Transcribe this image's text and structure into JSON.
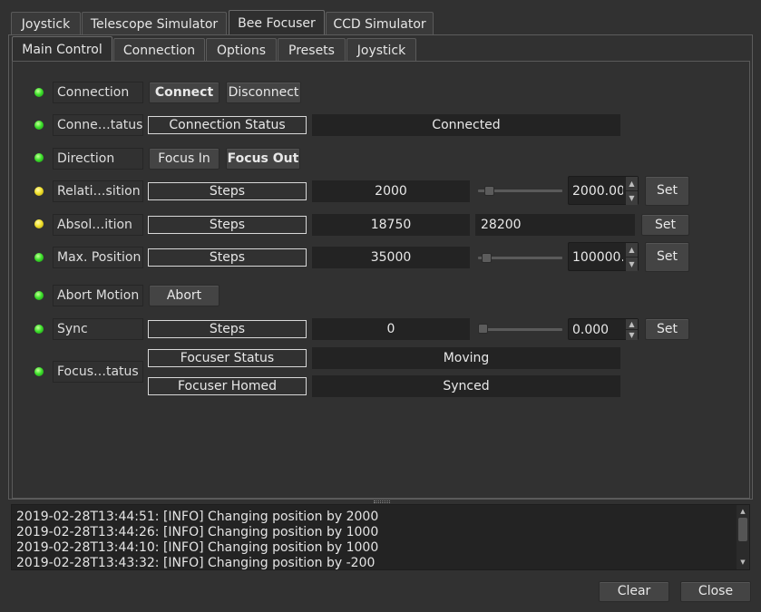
{
  "top_tabs": [
    {
      "label": "Joystick",
      "active": false
    },
    {
      "label": "Telescope Simulator",
      "active": false
    },
    {
      "label": "Bee Focuser",
      "active": true
    },
    {
      "label": "CCD Simulator",
      "active": false
    }
  ],
  "sub_tabs": [
    {
      "label": "Main Control",
      "active": true
    },
    {
      "label": "Connection",
      "active": false
    },
    {
      "label": "Options",
      "active": false
    },
    {
      "label": "Presets",
      "active": false
    },
    {
      "label": "Joystick",
      "active": false
    }
  ],
  "colors": {
    "led_green": "#3ee22c",
    "led_yellow": "#f2e12c"
  },
  "rows": {
    "connection": {
      "status": "green",
      "label": "Connection",
      "connect": "Connect",
      "disconnect": "Disconnect"
    },
    "conn_status": {
      "status": "green",
      "label": "Conne…tatus",
      "field_label": "Connection Status",
      "value": "Connected"
    },
    "direction": {
      "status": "green",
      "label": "Direction",
      "focus_in": "Focus In",
      "focus_out": "Focus Out"
    },
    "relative": {
      "status": "yellow",
      "label": "Relati…sition",
      "unit": "Steps",
      "value": "2000",
      "spin": "2000.00",
      "set": "Set",
      "slider_pct": 8
    },
    "absolute": {
      "status": "yellow",
      "label": "Absol…ition",
      "unit": "Steps",
      "value": "18750",
      "input": "28200",
      "set": "Set"
    },
    "max_position": {
      "status": "green",
      "label": "Max. Position",
      "unit": "Steps",
      "value": "35000",
      "spin": "100000.0",
      "set": "Set",
      "slider_pct": 5
    },
    "abort": {
      "status": "green",
      "label": "Abort Motion",
      "button": "Abort"
    },
    "sync": {
      "status": "green",
      "label": "Sync",
      "unit": "Steps",
      "value": "0",
      "spin": "0.000",
      "set": "Set",
      "slider_pct": 0
    },
    "focuser_status": {
      "status": "green",
      "label": "Focus…tatus",
      "status_label": "Focuser Status",
      "status_value": "Moving",
      "homed_label": "Focuser Homed",
      "homed_value": "Synced"
    }
  },
  "log": [
    "2019-02-28T13:44:51: [INFO] Changing position by 2000",
    "2019-02-28T13:44:26: [INFO] Changing position by 1000",
    "2019-02-28T13:44:10: [INFO] Changing position by 1000",
    "2019-02-28T13:43:32: [INFO] Changing position by -200"
  ],
  "footer": {
    "clear": "Clear",
    "close": "Close"
  }
}
